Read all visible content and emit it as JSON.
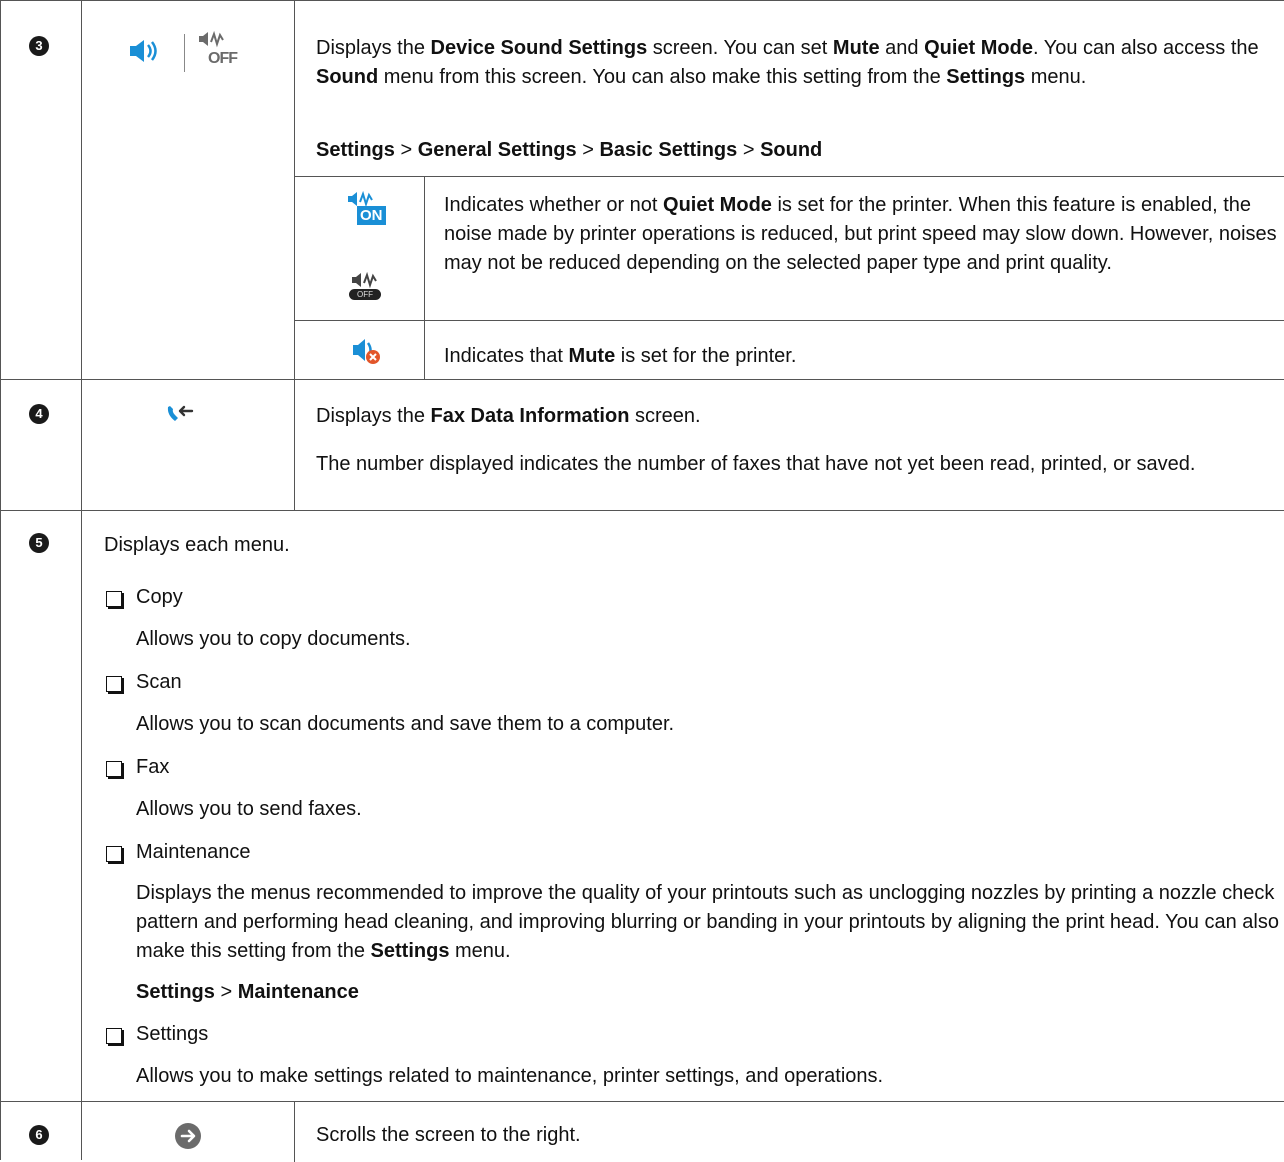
{
  "rows": {
    "r3": {
      "number": "3",
      "desc": {
        "pre": "Displays the ",
        "b1": "Device Sound Settings",
        "m1": " screen. You can set ",
        "b2": "Mute",
        "m2": " and ",
        "b3": "Quiet Mode",
        "m3": ". You can also access the ",
        "b4": "Sound",
        "m4": " menu from this screen. You can also make this setting from the ",
        "b5": "Settings",
        "m5": " menu."
      },
      "path": {
        "p1": "Settings",
        "sep1": " > ",
        "p2": "General Settings",
        "sep2": " > ",
        "p3": "Basic Settings",
        "sep3": " > ",
        "p4": "Sound"
      },
      "sub1": {
        "pre": "Indicates whether or not ",
        "b1": "Quiet Mode",
        "post": " is set for the printer. When this feature is enabled, the noise made by printer operations is reduced, but print speed may slow down. However, noises may not be reduced depending on the selected paper type and print quality.",
        "icon_on_label": "ON",
        "icon_off_label": "OFF"
      },
      "sub2": {
        "pre": "Indicates that ",
        "b1": "Mute",
        "post": " is set for the printer."
      },
      "icon_label": "OFF"
    },
    "r4": {
      "number": "4",
      "line1": {
        "pre": "Displays the ",
        "b1": "Fax Data Information",
        "post": " screen."
      },
      "line2": "The number displayed indicates the number of faxes that have not yet been read, printed, or saved."
    },
    "r5": {
      "number": "5",
      "intro": "Displays each menu.",
      "items": [
        {
          "label": "Copy",
          "desc": "Allows you to copy documents."
        },
        {
          "label": "Scan",
          "desc": "Allows you to scan documents and save them to a computer."
        },
        {
          "label": "Fax",
          "desc": "Allows you to send faxes."
        },
        {
          "label": "Maintenance",
          "desc_pre": "Displays the menus recommended to improve the quality of your printouts such as unclogging nozzles by printing a nozzle check pattern and performing head cleaning, and improving blurring or banding in your printouts by aligning the print head. You can also make this setting from the ",
          "desc_b": "Settings",
          "desc_post": " menu.",
          "path_b1": "Settings",
          "path_sep": " > ",
          "path_b2": "Maintenance"
        },
        {
          "label": "Settings",
          "desc": "Allows you to make settings related to maintenance, printer settings, and operations."
        }
      ]
    },
    "r6": {
      "number": "6",
      "desc": "Scrolls the screen to the right."
    }
  },
  "colors": {
    "accent_blue": "#1a8fd6",
    "mute_red": "#e2562a",
    "icon_gray": "#6b6b6b"
  }
}
